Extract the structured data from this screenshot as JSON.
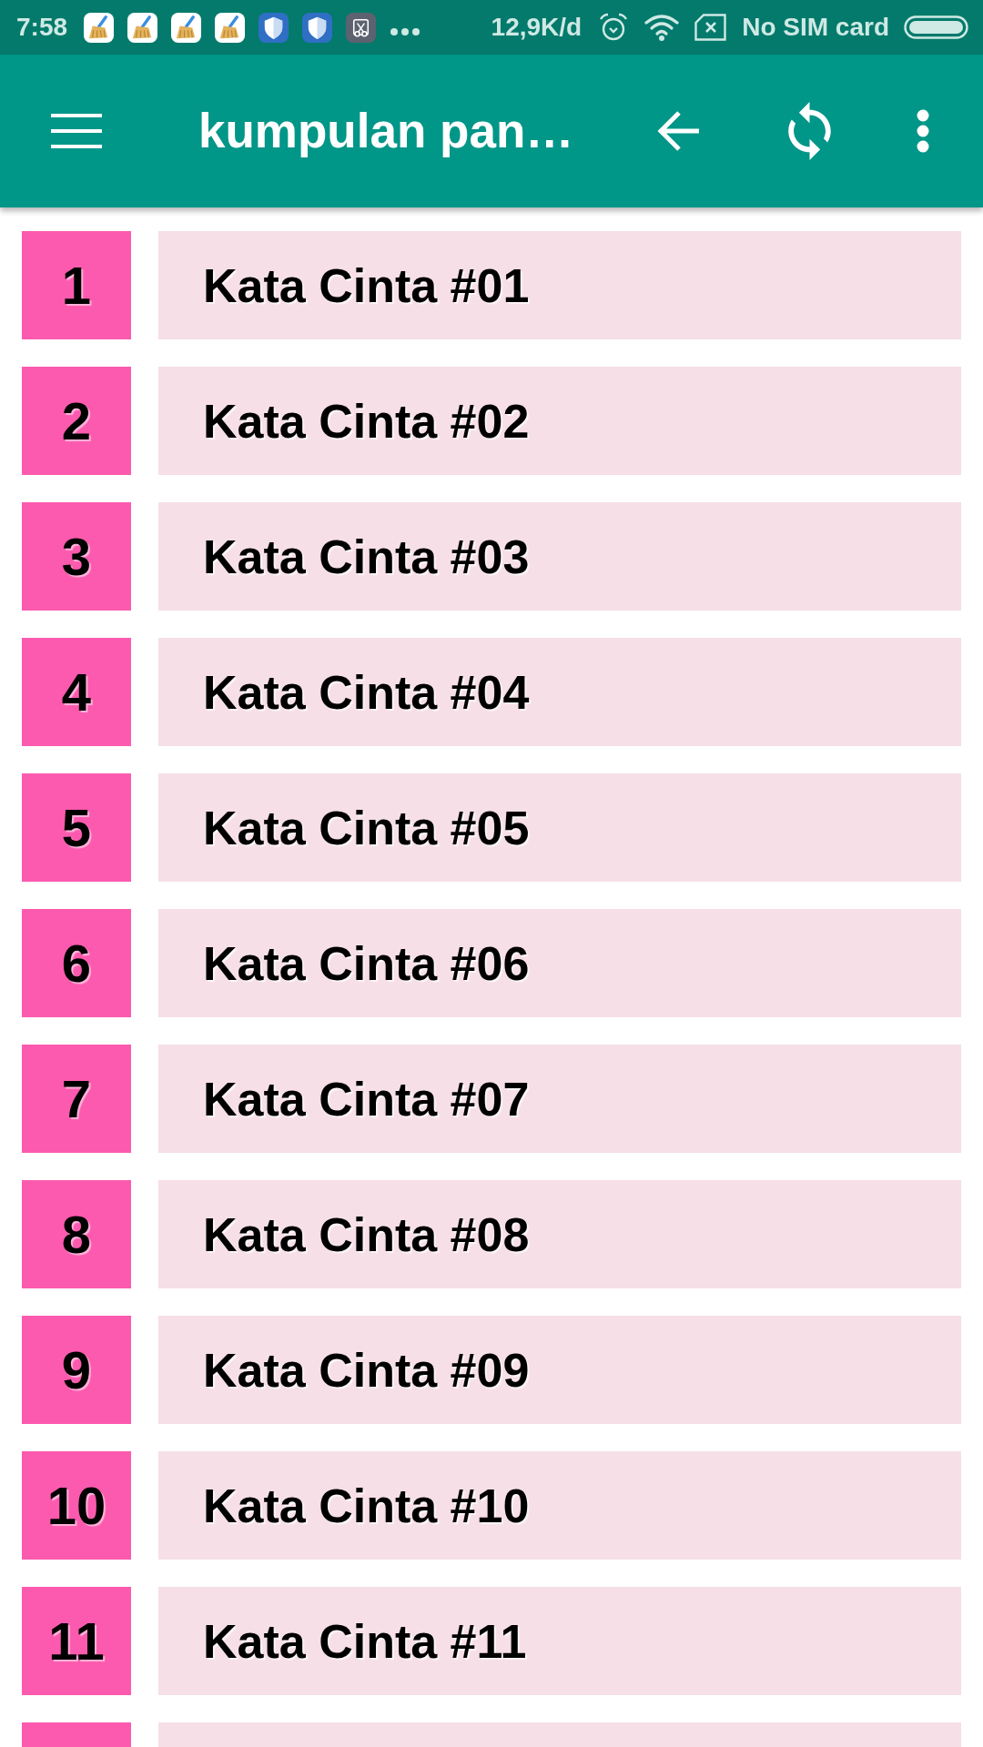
{
  "status_bar": {
    "time": "7:58",
    "network_speed": "12,9K/d",
    "sim_status": "No SIM card"
  },
  "app_bar": {
    "title": "kumpulan pan…"
  },
  "items": [
    {
      "number": "1",
      "title": "Kata Cinta #01"
    },
    {
      "number": "2",
      "title": "Kata Cinta #02"
    },
    {
      "number": "3",
      "title": "Kata Cinta #03"
    },
    {
      "number": "4",
      "title": "Kata Cinta #04"
    },
    {
      "number": "5",
      "title": "Kata Cinta #05"
    },
    {
      "number": "6",
      "title": "Kata Cinta #06"
    },
    {
      "number": "7",
      "title": "Kata Cinta #07"
    },
    {
      "number": "8",
      "title": "Kata Cinta #08"
    },
    {
      "number": "9",
      "title": "Kata Cinta #09"
    },
    {
      "number": "10",
      "title": "Kata Cinta #10"
    },
    {
      "number": "11",
      "title": "Kata Cinta #11"
    }
  ]
}
